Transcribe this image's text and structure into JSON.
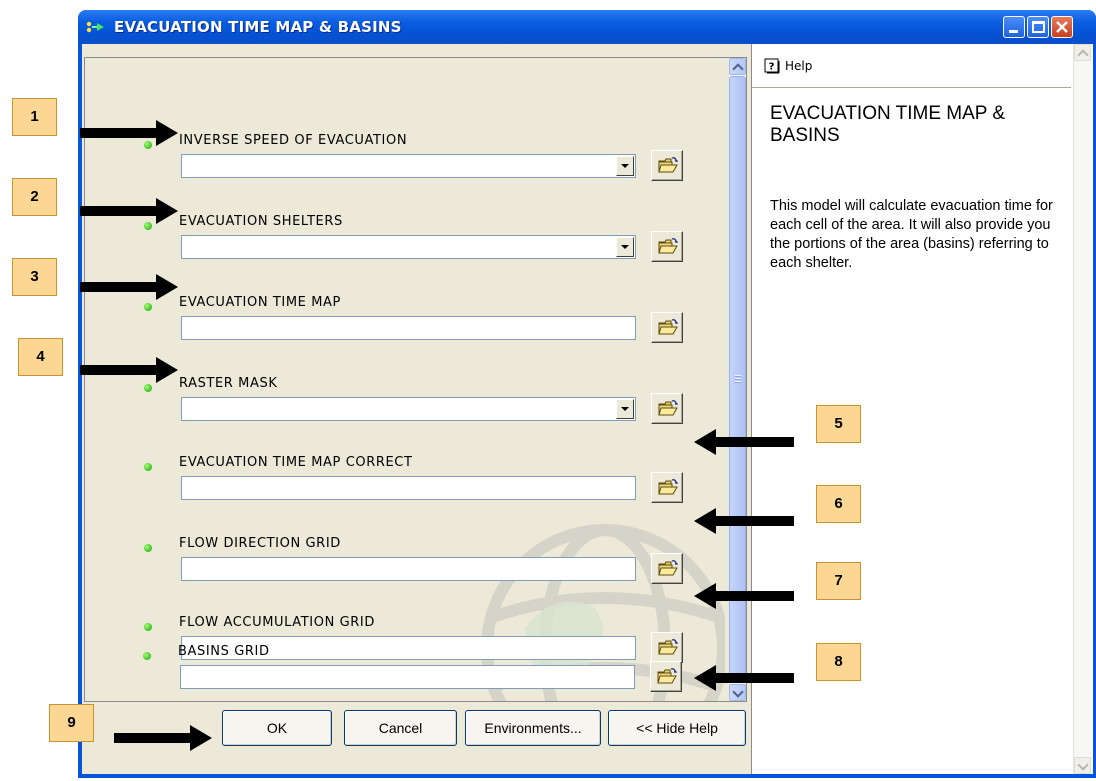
{
  "window": {
    "title": "EVACUATION TIME MAP & BASINS"
  },
  "params": [
    {
      "label": "INVERSE SPEED OF EVACUATION",
      "value": "",
      "dropdown": true
    },
    {
      "label": "EVACUATION SHELTERS",
      "value": "",
      "dropdown": true
    },
    {
      "label": "EVACUATION TIME MAP",
      "value": "",
      "dropdown": false
    },
    {
      "label": "RASTER MASK",
      "value": "",
      "dropdown": true
    },
    {
      "label": "EVACUATION TIME MAP CORRECT",
      "value": "",
      "dropdown": false
    },
    {
      "label": "FLOW DIRECTION GRID",
      "value": "",
      "dropdown": false
    },
    {
      "label": "FLOW ACCUMULATION GRID",
      "value": "",
      "dropdown": false
    },
    {
      "label": "BASINS GRID",
      "value": "",
      "dropdown": false
    }
  ],
  "buttons": {
    "ok": "OK",
    "cancel": "Cancel",
    "environments": "Environments...",
    "hide_help": "<< Hide Help"
  },
  "help": {
    "tab_label": "Help",
    "title": "EVACUATION TIME MAP & BASINS",
    "body": "This model will calculate evacuation time for each cell of the area. It will also provide you the portions of the area (basins) referring to each shelter."
  },
  "callouts": [
    "1",
    "2",
    "3",
    "4",
    "5",
    "6",
    "7",
    "8",
    "9"
  ],
  "colors": {
    "titlebar": "#0a5de0",
    "dialog_bg": "#ece9d8",
    "required_dot": "#18a010",
    "callout_fill": "#fbd793"
  }
}
